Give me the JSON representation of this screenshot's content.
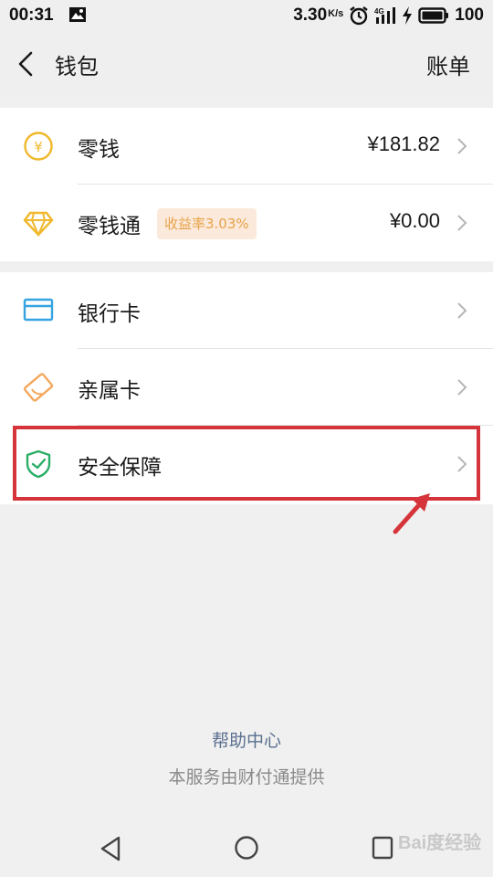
{
  "status_bar": {
    "time": "00:31",
    "speed": "3.30",
    "speed_unit": "K/s",
    "network": "4G",
    "battery": "100"
  },
  "nav": {
    "title": "钱包",
    "action": "账单"
  },
  "group1": [
    {
      "label": "零钱",
      "value": "¥181.82",
      "icon": "yuan-coin-icon"
    },
    {
      "label": "零钱通",
      "badge": "收益率3.03%",
      "value": "¥0.00",
      "icon": "diamond-icon"
    }
  ],
  "group2": [
    {
      "label": "银行卡",
      "icon": "bank-card-icon"
    },
    {
      "label": "亲属卡",
      "icon": "family-card-icon"
    },
    {
      "label": "安全保障",
      "icon": "shield-check-icon"
    }
  ],
  "footer": {
    "help": "帮助中心",
    "note": "本服务由财付通提供"
  },
  "watermark": "Bai度经验",
  "colors": {
    "accent_yellow": "#f0b82c",
    "bank_blue": "#35a4e0",
    "family_orange": "#f3a85d",
    "shield_green": "#2aae67",
    "badge_bg": "#fbeadb",
    "badge_text": "#e8a24a",
    "highlight_red": "#d6343b",
    "link_blue": "#5a6f8f"
  }
}
